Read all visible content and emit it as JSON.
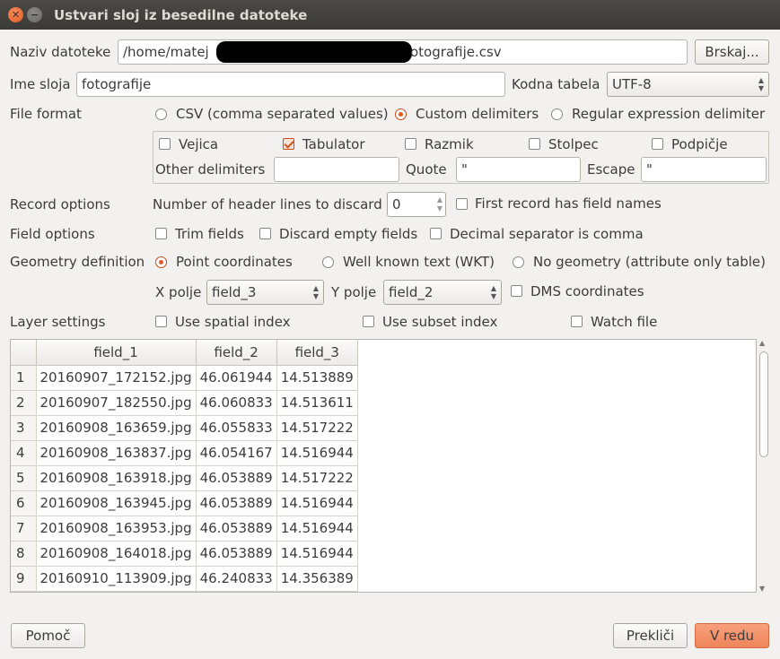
{
  "window": {
    "title": "Ustvari sloj iz besedilne datoteke"
  },
  "file": {
    "label": "Naziv datoteke",
    "path_prefix": "/home/matej",
    "path_suffix": "otografije.csv",
    "browse": "Brskaj..."
  },
  "layer": {
    "label": "Ime sloja",
    "value": "fotografije",
    "encoding_label": "Kodna tabela",
    "encoding_value": "UTF-8"
  },
  "format": {
    "label": "File format",
    "options": [
      "CSV (comma separated values)",
      "Custom delimiters",
      "Regular expression delimiter"
    ],
    "selected": 1
  },
  "delimiters": {
    "vejica": "Vejica",
    "tabulator": "Tabulator",
    "razmik": "Razmik",
    "stolpec": "Stolpec",
    "podpicje": "Podpičje",
    "other_label": "Other delimiters",
    "other_value": "",
    "quote_label": "Quote",
    "quote_value": "\"",
    "escape_label": "Escape",
    "escape_value": "\""
  },
  "record": {
    "label": "Record options",
    "header_lines_label": "Number of header lines to discard",
    "header_lines_value": "0",
    "first_record": "First record has field names"
  },
  "field_options": {
    "label": "Field options",
    "trim": "Trim fields",
    "discard": "Discard empty fields",
    "decimal": "Decimal separator is comma"
  },
  "geometry": {
    "label": "Geometry definition",
    "options": [
      "Point coordinates",
      "Well known text (WKT)",
      "No geometry (attribute only table)"
    ],
    "selected": 0,
    "x_label": "X polje",
    "x_value": "field_3",
    "y_label": "Y polje",
    "y_value": "field_2",
    "dms": "DMS coordinates"
  },
  "layer_settings": {
    "label": "Layer settings",
    "spatial": "Use spatial index",
    "subset": "Use subset index",
    "watch": "Watch file"
  },
  "table": {
    "columns": [
      "field_1",
      "field_2",
      "field_3"
    ],
    "rows": [
      [
        "1",
        "20160907_172152.jpg",
        "46.061944",
        "14.513889"
      ],
      [
        "2",
        "20160907_182550.jpg",
        "46.060833",
        "14.513611"
      ],
      [
        "3",
        "20160908_163659.jpg",
        "46.055833",
        "14.517222"
      ],
      [
        "4",
        "20160908_163837.jpg",
        "46.054167",
        "14.516944"
      ],
      [
        "5",
        "20160908_163918.jpg",
        "46.053889",
        "14.517222"
      ],
      [
        "6",
        "20160908_163945.jpg",
        "46.053889",
        "14.516944"
      ],
      [
        "7",
        "20160908_163953.jpg",
        "46.053889",
        "14.516944"
      ],
      [
        "8",
        "20160908_164018.jpg",
        "46.053889",
        "14.516944"
      ],
      [
        "9",
        "20160910_113909.jpg",
        "46.240833",
        "14.356389"
      ]
    ]
  },
  "buttons": {
    "help": "Pomoč",
    "cancel": "Prekliči",
    "ok": "V redu"
  }
}
